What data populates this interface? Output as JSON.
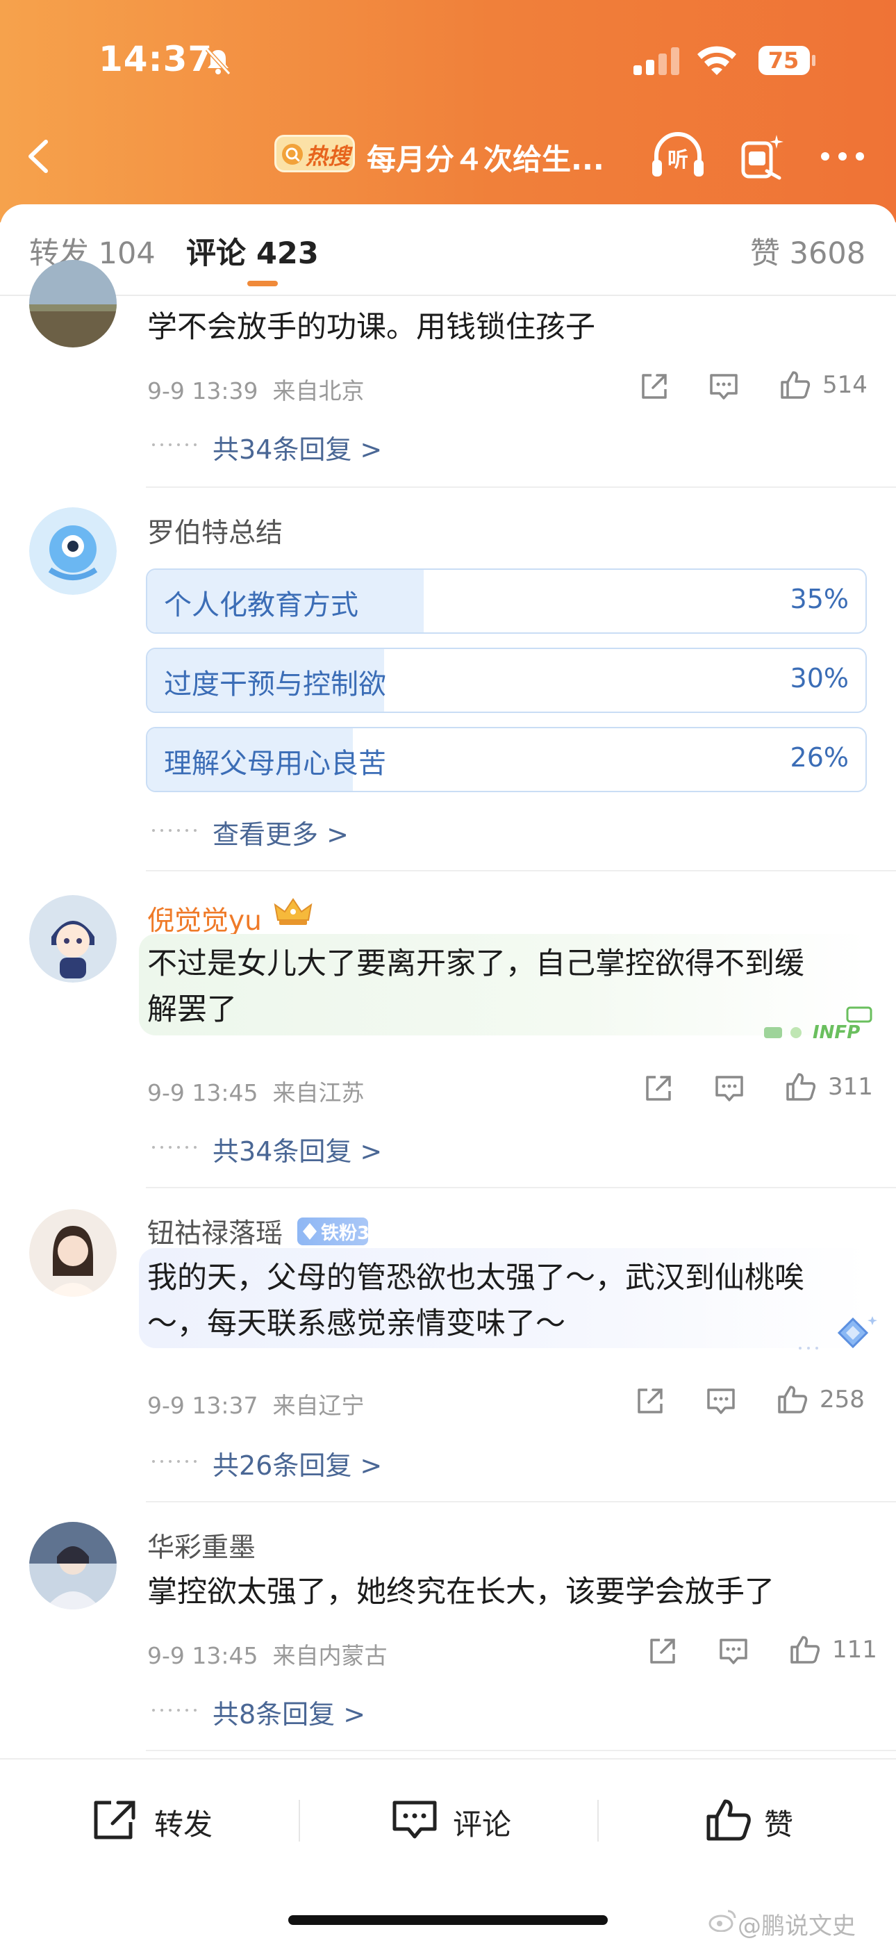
{
  "status_bar": {
    "time": "14:37",
    "battery": "75"
  },
  "header": {
    "hot_badge": "热搜",
    "title": "每月分４次给生..."
  },
  "tabs": {
    "repost_label": "转发",
    "repost_count": "104",
    "comment_label": "评论",
    "comment_count": "423",
    "like_label": "赞",
    "like_count": "3608"
  },
  "comments": [
    {
      "text": "学不会放手的功课。用钱锁住孩子",
      "time": "9-9 13:39",
      "location": "来自北京",
      "likes": "514",
      "replies": "共34条回复 >"
    },
    {
      "name": "罗伯特总结",
      "poll": [
        {
          "label": "个人化教育方式",
          "percent": "35%",
          "fraction": 0.35
        },
        {
          "label": "过度干预与控制欲",
          "percent": "30%",
          "fraction": 0.3
        },
        {
          "label": "理解父母用心良苦",
          "percent": "26%",
          "fraction": 0.26
        }
      ],
      "more": "查看更多 >"
    },
    {
      "name": "倪觉觉yu",
      "name_color": "#ef7a28",
      "text_line1": "不过是女儿大了要离开家了，自己掌控欲得不到缓",
      "text_line2": "解罢了",
      "time": "9-9 13:45",
      "location": "来自江苏",
      "likes": "311",
      "replies": "共34条回复 >",
      "decoration": "INFP"
    },
    {
      "name": "钮祜禄落瑶",
      "badge": "铁粉3",
      "text_line1": "我的天，父母的管恐欲也太强了～，武汉到仙桃唉",
      "text_line2": "～，每天联系感觉亲情变味了～",
      "time": "9-9 13:37",
      "location": "来自辽宁",
      "likes": "258",
      "replies": "共26条回复 >"
    },
    {
      "name": "华彩重墨",
      "text": "掌控欲太强了，她终究在长大，该要学会放手了",
      "time": "9-9 13:45",
      "location": "来自内蒙古",
      "likes": "111",
      "replies": "共8条回复 >"
    }
  ],
  "bottom_bar": {
    "repost": "转发",
    "comment": "评论",
    "like": "赞"
  },
  "watermark": "@鹏说文史",
  "colors": {
    "header_orange": "#f0803a",
    "link_blue": "#4a6795",
    "poll_blue": "#3b6db6"
  }
}
